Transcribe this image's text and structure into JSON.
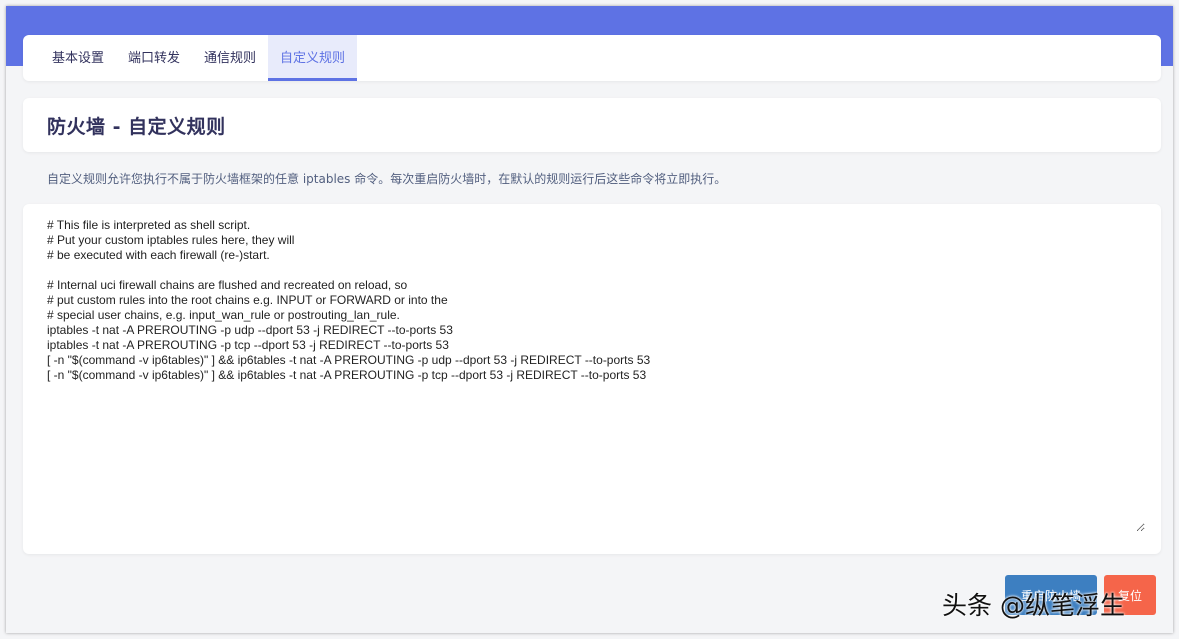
{
  "tabs": [
    {
      "label": "基本设置"
    },
    {
      "label": "端口转发"
    },
    {
      "label": "通信规则"
    },
    {
      "label": "自定义规则"
    }
  ],
  "page": {
    "title": "防火墙 - 自定义规则",
    "description": "自定义规则允许您执行不属于防火墙框架的任意 iptables 命令。每次重启防火墙时，在默认的规则运行后这些命令将立即执行。"
  },
  "editor": {
    "content": "# This file is interpreted as shell script.\n# Put your custom iptables rules here, they will\n# be executed with each firewall (re-)start.\n\n# Internal uci firewall chains are flushed and recreated on reload, so\n# put custom rules into the root chains e.g. INPUT or FORWARD or into the\n# special user chains, e.g. input_wan_rule or postrouting_lan_rule.\niptables -t nat -A PREROUTING -p udp --dport 53 -j REDIRECT --to-ports 53\niptables -t nat -A PREROUTING -p tcp --dport 53 -j REDIRECT --to-ports 53\n[ -n \"$(command -v ip6tables)\" ] && ip6tables -t nat -A PREROUTING -p udp --dport 53 -j REDIRECT --to-ports 53\n[ -n \"$(command -v ip6tables)\" ] && ip6tables -t nat -A PREROUTING -p tcp --dport 53 -j REDIRECT --to-ports 53"
  },
  "buttons": {
    "restart_label": "重启防火墙",
    "reset_label": "复位"
  },
  "watermark": "头条 @纵笔浮生",
  "colors": {
    "accent": "#5e72e4",
    "restart_button": "#3d7fc1",
    "reset_button": "#f5654a"
  }
}
